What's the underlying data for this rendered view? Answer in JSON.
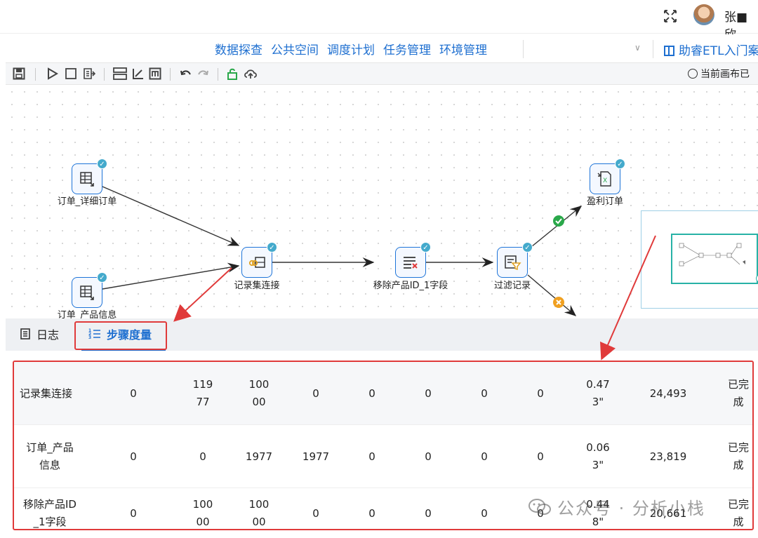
{
  "header": {
    "username": "张■欣"
  },
  "nav": {
    "items": [
      "数据探查",
      "公共空间",
      "调度计划",
      "任务管理",
      "环境管理"
    ],
    "help_link": "助睿ETL入门案"
  },
  "toolbar": {
    "canvas_status": "当前画布已"
  },
  "canvas": {
    "nodes": {
      "order_detail": "订单_详细订单",
      "product_info": "订单_产品信息",
      "join": "记录集连接",
      "remove_field": "移除产品ID_1字段",
      "filter": "过滤记录",
      "profit_order": "盈利订单"
    }
  },
  "panel": {
    "tab_log": "日志",
    "tab_metrics": "步骤度量"
  },
  "metrics_table": {
    "rows": [
      {
        "name": "记录集连接",
        "c1": "0",
        "c2": "11977",
        "c3": "10000",
        "c4": "0",
        "c5": "0",
        "c6": "0",
        "c7": "0",
        "c8": "0",
        "time": "0.473\"",
        "speed": "24,493",
        "status": "已完成"
      },
      {
        "name": "订单_产品信息",
        "c1": "0",
        "c2": "0",
        "c3": "1977",
        "c4": "1977",
        "c5": "0",
        "c6": "0",
        "c7": "0",
        "c8": "0",
        "time": "0.063\"",
        "speed": "23,819",
        "status": "已完成"
      },
      {
        "name": "移除产品ID_1字段",
        "c1": "0",
        "c2": "10000",
        "c3": "10000",
        "c4": "0",
        "c5": "0",
        "c6": "0",
        "c7": "0",
        "c8": "0",
        "time": "0.448\"",
        "speed": "20,661",
        "status": "已完成"
      }
    ]
  },
  "watermark": {
    "text": "公众号 · 分析小栈"
  },
  "colors": {
    "accent": "#1e6fd0",
    "highlight": "#e03a3a",
    "success": "#2aa84a",
    "warning": "#f0a020"
  }
}
